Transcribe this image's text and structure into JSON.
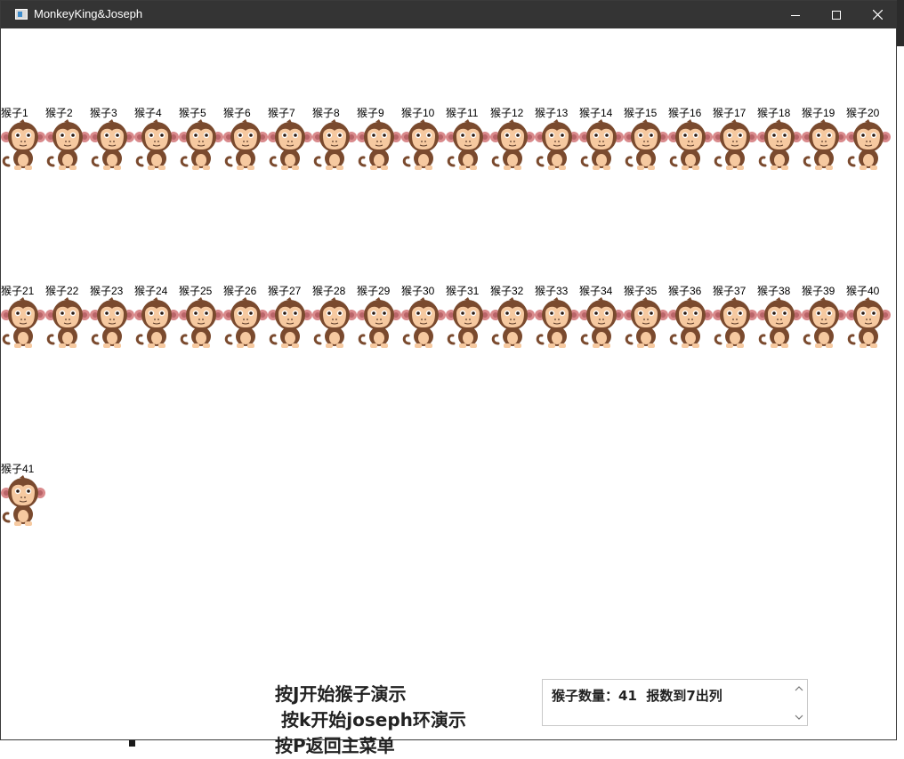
{
  "window": {
    "title": "MonkeyKing&Joseph",
    "controls": [
      "minimize",
      "maximize",
      "close"
    ]
  },
  "monkeys": [
    {
      "label": "猴子1"
    },
    {
      "label": "猴子2"
    },
    {
      "label": "猴子3"
    },
    {
      "label": "猴子4"
    },
    {
      "label": "猴子5"
    },
    {
      "label": "猴子6"
    },
    {
      "label": "猴子7"
    },
    {
      "label": "猴子8"
    },
    {
      "label": "猴子9"
    },
    {
      "label": "猴子10"
    },
    {
      "label": "猴子11"
    },
    {
      "label": "猴子12"
    },
    {
      "label": "猴子13"
    },
    {
      "label": "猴子14"
    },
    {
      "label": "猴子15"
    },
    {
      "label": "猴子16"
    },
    {
      "label": "猴子17"
    },
    {
      "label": "猴子18"
    },
    {
      "label": "猴子19"
    },
    {
      "label": "猴子20"
    },
    {
      "label": "猴子21"
    },
    {
      "label": "猴子22"
    },
    {
      "label": "猴子23"
    },
    {
      "label": "猴子24"
    },
    {
      "label": "猴子25"
    },
    {
      "label": "猴子26"
    },
    {
      "label": "猴子27"
    },
    {
      "label": "猴子28"
    },
    {
      "label": "猴子29"
    },
    {
      "label": "猴子30"
    },
    {
      "label": "猴子31"
    },
    {
      "label": "猴子32"
    },
    {
      "label": "猴子33"
    },
    {
      "label": "猴子34"
    },
    {
      "label": "猴子35"
    },
    {
      "label": "猴子36"
    },
    {
      "label": "猴子37"
    },
    {
      "label": "猴子38"
    },
    {
      "label": "猴子39"
    },
    {
      "label": "猴子40"
    },
    {
      "label": "猴子41"
    }
  ],
  "instructions": [
    "按J开始猴子演示",
    " 按k开始joseph环演示",
    "按P返回主菜单"
  ],
  "status": {
    "text": "猴子数量：41  报数到7出列"
  },
  "colors": {
    "titlebar": "#343434",
    "monkey_fur": "#7a4a2e",
    "monkey_face": "#f6c9a0",
    "monkey_ear": "#d9898b"
  }
}
